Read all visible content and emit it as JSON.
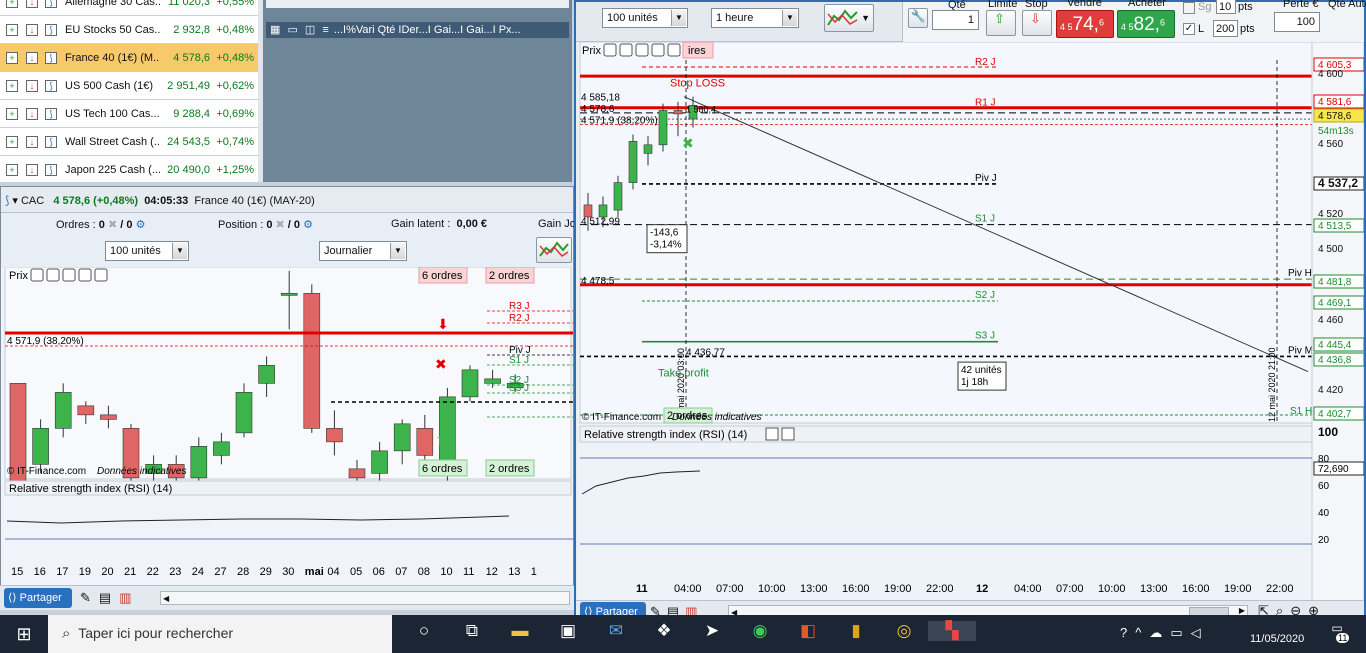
{
  "watchlist": [
    {
      "name": "Allemagne 30 Cas...",
      "price": "11 020,3",
      "change": "+0,55%"
    },
    {
      "name": "EU Stocks 50 Cas...",
      "price": "2 932,8",
      "change": "+0,48%"
    },
    {
      "name": "France 40 (1€) (M...",
      "price": "4 578,6",
      "change": "+0,48%"
    },
    {
      "name": "US 500 Cash (1€)",
      "price": "2 951,49",
      "change": "+0,62%"
    },
    {
      "name": "US Tech 100 Cas...",
      "price": "9 288,4",
      "change": "+0,69%"
    },
    {
      "name": "Wall Street Cash (...",
      "price": "24 543,5",
      "change": "+0,74%"
    },
    {
      "name": "Japon 225 Cash (...",
      "price": "20 490,0",
      "change": "+1,25%"
    }
  ],
  "mid_header": "...I%Vari  Qté  IDer...I Gai...I Gai...I Px...",
  "cac": {
    "ticker": "CAC",
    "quote": "4 578,6 (+0,48%)",
    "time": "04:05:33",
    "instrument": "France 40 (1€) (MAY-20)",
    "orders_label": "Ordres :",
    "orders_val1": "0",
    "orders_val2": "/ 0",
    "position_label": "Position :",
    "position_val1": "0",
    "position_val2": "/ 0",
    "gain_label": "Gain latent :",
    "gain_val": "0,00 €",
    "gain_jour": "Gain Jo",
    "qty_select": "100 unités",
    "period_select": "Journalier",
    "price_tab": "Prix",
    "orders_top_left": "6 ordres",
    "orders_top_right": "2 ordres",
    "orders_bot_left": "6 ordres",
    "orders_bot_right": "2 ordres",
    "fib_label": "4 571,9 (38,20%)",
    "r3": "R3 J",
    "r2": "R2 J",
    "piv": "Piv J",
    "s1": "S1 J",
    "s2": "S2 J",
    "s3": "S3 J",
    "source": "© IT-Finance.com",
    "source_note": "Données indicatives",
    "rsi_title": "Relative strength index (RSI) (14)",
    "dates": [
      "15",
      "16",
      "17",
      "19",
      "20",
      "21",
      "22",
      "23",
      "24",
      "27",
      "28",
      "29",
      "30",
      "mai",
      "04",
      "05",
      "06",
      "07",
      "08",
      "10",
      "11",
      "12",
      "13",
      "1"
    ]
  },
  "hourly": {
    "qty_select": "100 unités",
    "period_select": "1 heure",
    "qte_label": "Qté",
    "qte_val": "1",
    "limit_label": "Limite",
    "stop_label": "Stop",
    "sell_label": "Vendre",
    "sell_prefix": "4 5",
    "sell_big": "74,",
    "sell_small": "6",
    "buy_label": "Acheter",
    "buy_prefix": "4 5",
    "buy_big": "82,",
    "buy_small": "6",
    "sg_label": "Sg",
    "sg_val": "10",
    "pts1": "pts",
    "l_label": "L",
    "l_val": "200",
    "pts2": "pts",
    "perte_label": "Perte €",
    "perte_val": "100",
    "qte_auto": "Qté Auto",
    "price_tab": "Prix",
    "tab_ordres": "ires",
    "r2": "R2 J",
    "r1": "R1 J",
    "piv": "Piv J",
    "s1": "S1 J",
    "s2": "S2 J",
    "s3": "S3 J",
    "pivh": "Piv H",
    "pivm": "Piv M",
    "s1h": "S1 H",
    "stop_loss": "Stop LOSS",
    "take_profit": "Take profit",
    "stop_qty": "1 580,4",
    "lvl_4585": "4 585,18",
    "lvl_4578": "4 578,6",
    "lvl_fib": "4 571,9 (38,20%)",
    "lvl_4512": "4 512,99",
    "lvl_4478": "4 478,5",
    "lvl_4436": "4 436,77",
    "measure_val": "-143,6",
    "measure_pct": "-3,14%",
    "units_box1": "42 unités",
    "units_box2": "1j 18h",
    "vlabel1": "11 mai 2020 03:00",
    "vlabel2": "12 mai 2020 21:00",
    "tp_orders": "2 ordres",
    "source": "© IT-Finance.com",
    "source_note": "Données indicatives",
    "rsi_title": "Relative strength index (RSI) (14)",
    "axis": [
      {
        "v": "4 605,3",
        "kind": "red"
      },
      {
        "v": "4 600",
        "kind": "plain"
      },
      {
        "v": "4 581,6",
        "kind": "red"
      },
      {
        "v": "4 578,6",
        "kind": "yellow"
      },
      {
        "v": "54m13s",
        "kind": "time"
      },
      {
        "v": "4 560",
        "kind": "plain"
      },
      {
        "v": "4 537,2",
        "kind": "bold"
      },
      {
        "v": "4 520",
        "kind": "plain"
      },
      {
        "v": "4 513,5",
        "kind": "green"
      },
      {
        "v": "4 500",
        "kind": "plain"
      },
      {
        "v": "4 481,8",
        "kind": "green"
      },
      {
        "v": "4 469,1",
        "kind": "green"
      },
      {
        "v": "4 460",
        "kind": "plain"
      },
      {
        "v": "4 445,4",
        "kind": "green"
      },
      {
        "v": "4 436,8",
        "kind": "green"
      },
      {
        "v": "4 420",
        "kind": "plain"
      },
      {
        "v": "4 402,7",
        "kind": "green"
      }
    ],
    "rsi_axis": [
      "100",
      "80",
      "72,690",
      "60",
      "40",
      "20"
    ],
    "times": [
      "11",
      "04:00",
      "07:00",
      "10:00",
      "13:00",
      "16:00",
      "19:00",
      "22:00",
      "12",
      "04:00",
      "07:00",
      "10:00",
      "13:00",
      "16:00",
      "19:00",
      "22:00"
    ]
  },
  "share_label": "Partager",
  "taskbar": {
    "search": "Taper ici pour rechercher",
    "date": "11/05/2020",
    "notif": "11"
  },
  "colors": {
    "up": "#3cb44b",
    "down": "#e06666",
    "pivot_red": "#e00000",
    "pivot_green": "#1e8c2e"
  }
}
